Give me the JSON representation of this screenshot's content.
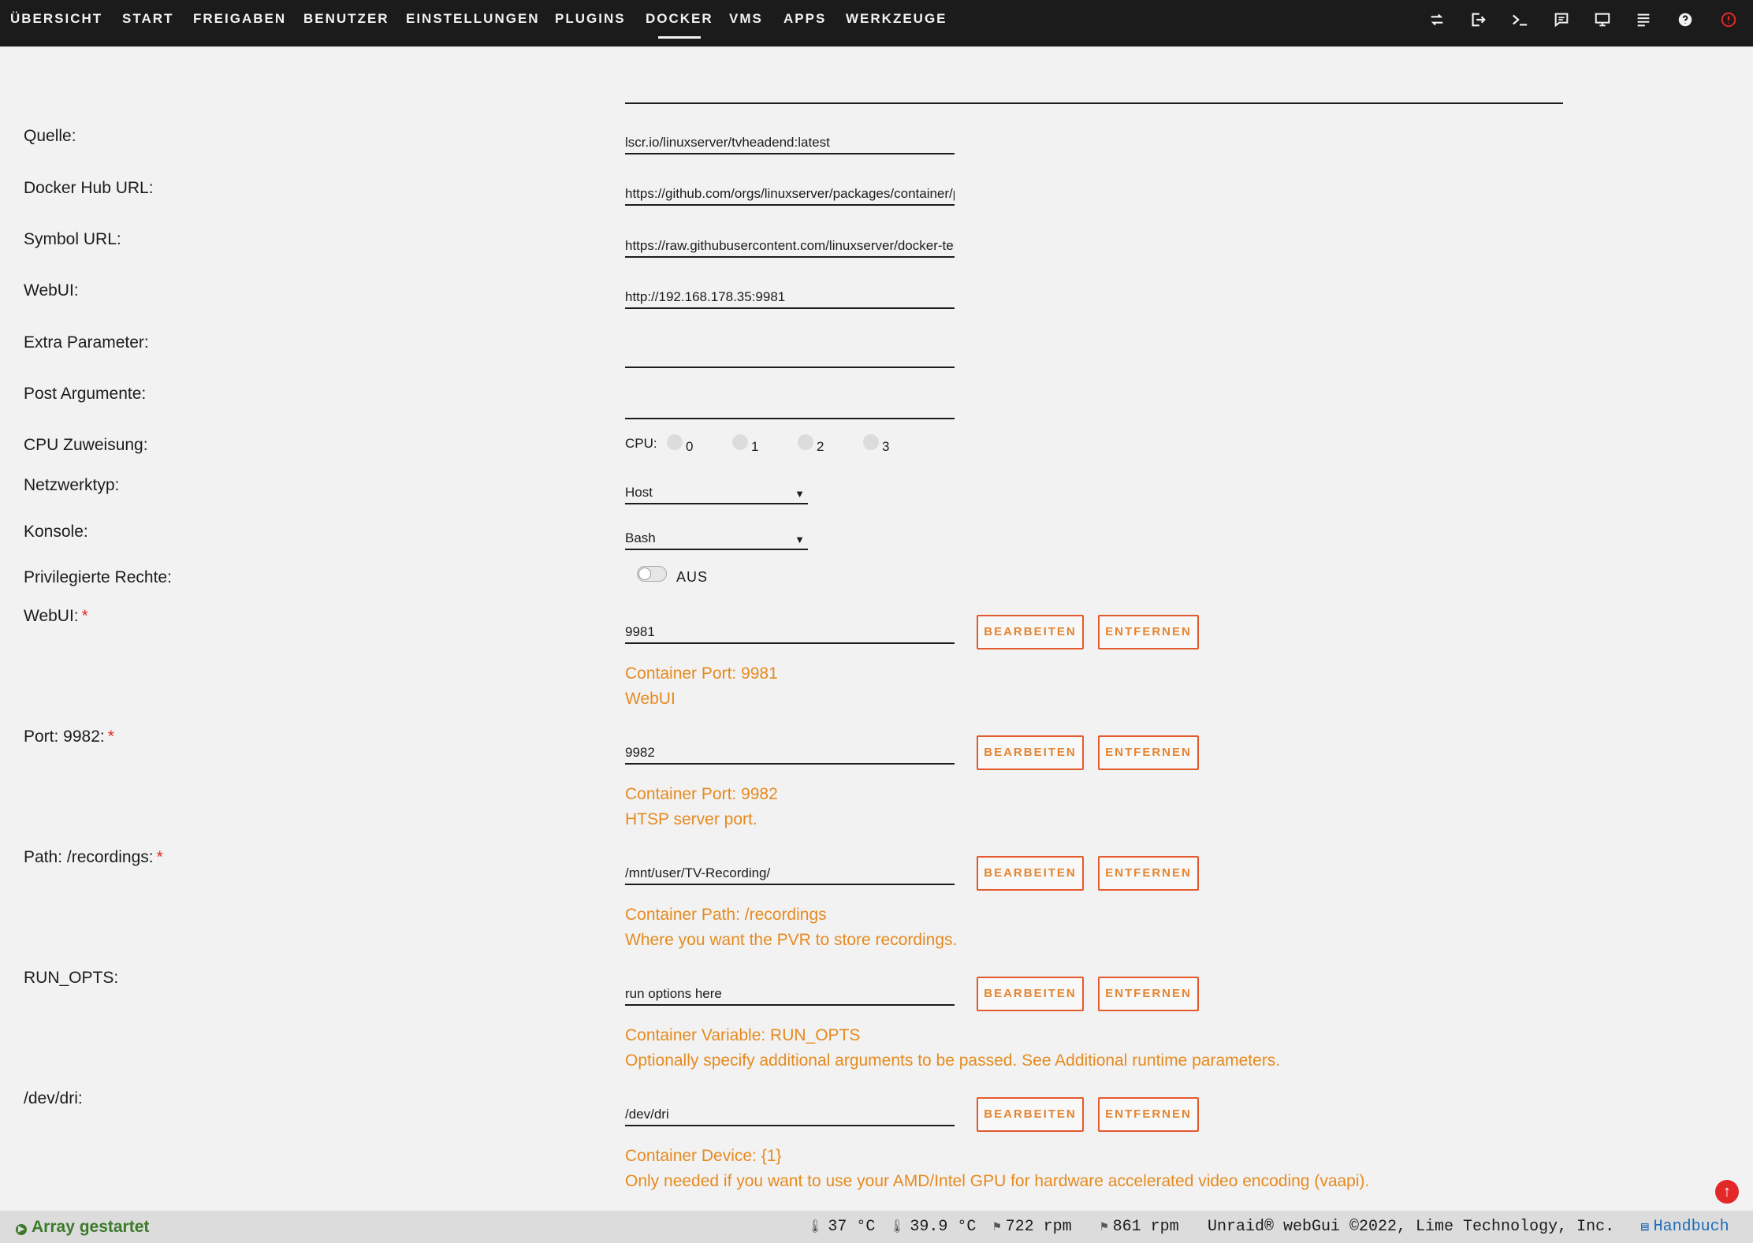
{
  "nav": {
    "items": [
      "ÜBERSICHT",
      "START",
      "FREIGABEN",
      "BENUTZER",
      "EINSTELLUNGEN",
      "PLUGINS",
      "DOCKER",
      "VMS",
      "APPS",
      "WERKZEUGE"
    ],
    "active": "DOCKER",
    "icons": [
      "switch-icon",
      "logout-icon",
      "terminal-icon",
      "feedback-icon",
      "display-icon",
      "log-icon",
      "help-icon",
      "alert-icon"
    ]
  },
  "form": {
    "source": {
      "label": "Quelle:",
      "value": "lscr.io/linuxserver/tvheadend:latest"
    },
    "docker_hub": {
      "label": "Docker Hub URL:",
      "value": "https://github.com/orgs/linuxserver/packages/container/package/tvheadend"
    },
    "icon_url": {
      "label": "Symbol URL:",
      "value": "https://raw.githubusercontent.com/linuxserver/docker-templates/master/linuxserver.io/img/tvheadend-icon.png"
    },
    "webui": {
      "label": "WebUI:",
      "value": "http://192.168.178.35:9981"
    },
    "extra_params": {
      "label": "Extra Parameter:",
      "value": ""
    },
    "post_args": {
      "label": "Post Argumente:",
      "value": ""
    },
    "cpu": {
      "label": "CPU Zuweisung:",
      "prefix": "CPU:",
      "cores": [
        "0",
        "1",
        "2",
        "3"
      ]
    },
    "network": {
      "label": "Netzwerktyp:",
      "value": "Host"
    },
    "console": {
      "label": "Konsole:",
      "value": "Bash"
    },
    "privileged": {
      "label": "Privilegierte Rechte:",
      "state": "AUS"
    }
  },
  "mappings": [
    {
      "label": "WebUI:",
      "required": "*",
      "value": "9981",
      "hint1": "Container Port: 9981",
      "hint2": "WebUI"
    },
    {
      "label": "Port: 9982:",
      "required": "*",
      "value": "9982",
      "hint1": "Container Port: 9982",
      "hint2": "HTSP server port."
    },
    {
      "label": "Path: /recordings:",
      "required": "*",
      "value": "/mnt/user/TV-Recording/",
      "hint1": "Container Path: /recordings",
      "hint2": "Where you want the PVR to store recordings."
    },
    {
      "label": "RUN_OPTS:",
      "required": "",
      "value": "run options here",
      "hint1": "Container Variable: RUN_OPTS",
      "hint2": "Optionally specify additional arguments to be passed. See Additional runtime parameters."
    },
    {
      "label": "/dev/dri:",
      "required": "",
      "value": "/dev/dri",
      "hint1": "Container Device: {1}",
      "hint2": "Only needed if you want to use your AMD/Intel GPU for hardware accelerated video encoding (vaapi)."
    }
  ],
  "buttons": {
    "edit": "BEARBEITEN",
    "remove": "ENTFERNEN"
  },
  "footer": {
    "status": "Array gestartet",
    "temp1": "37 °C",
    "temp2": "39.9 °C",
    "fan1": "722 rpm",
    "fan2": "861 rpm",
    "copyright": "Unraid® webGui ©2022, Lime Technology, Inc.",
    "manual": "Handbuch"
  },
  "colors": {
    "accent": "#e68a1f",
    "button_border": "#e35a2c",
    "nav_bg": "#1c1b1b",
    "status_green": "#3c7a2a",
    "required": "#e22828"
  }
}
